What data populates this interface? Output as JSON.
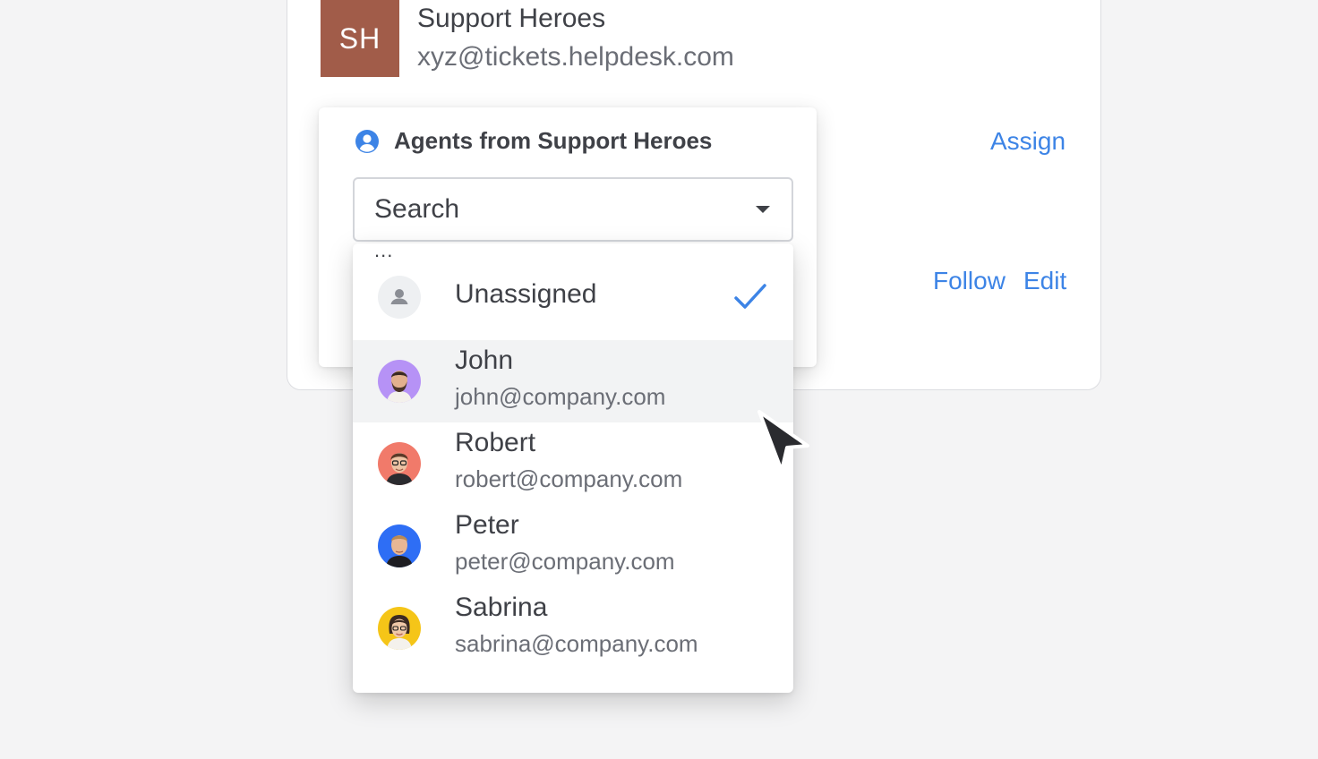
{
  "team": {
    "initials": "SH",
    "name": "Support Heroes",
    "email": "xyz@tickets.helpdesk.com",
    "avatar_color": "#a15c49"
  },
  "actions": {
    "assign": "Assign",
    "follow": "Follow",
    "edit": "Edit",
    "link_color": "#3d84e6"
  },
  "popover": {
    "title": "Agents from Support Heroes",
    "icon": "user-circle-icon",
    "search_placeholder": "Search"
  },
  "dropdown": {
    "ellipsis": "...",
    "unassigned_label": "Unassigned",
    "unassigned_selected": true,
    "agents": [
      {
        "name": "John",
        "email": "john@company.com",
        "avatar_bg": "#b692f6",
        "hovered": true
      },
      {
        "name": "Robert",
        "email": "robert@company.com",
        "avatar_bg": "#f17a6a",
        "hovered": false
      },
      {
        "name": "Peter",
        "email": "peter@company.com",
        "avatar_bg": "#2e6ef5",
        "hovered": false
      },
      {
        "name": "Sabrina",
        "email": "sabrina@company.com",
        "avatar_bg": "#f5c518",
        "hovered": false
      }
    ]
  }
}
